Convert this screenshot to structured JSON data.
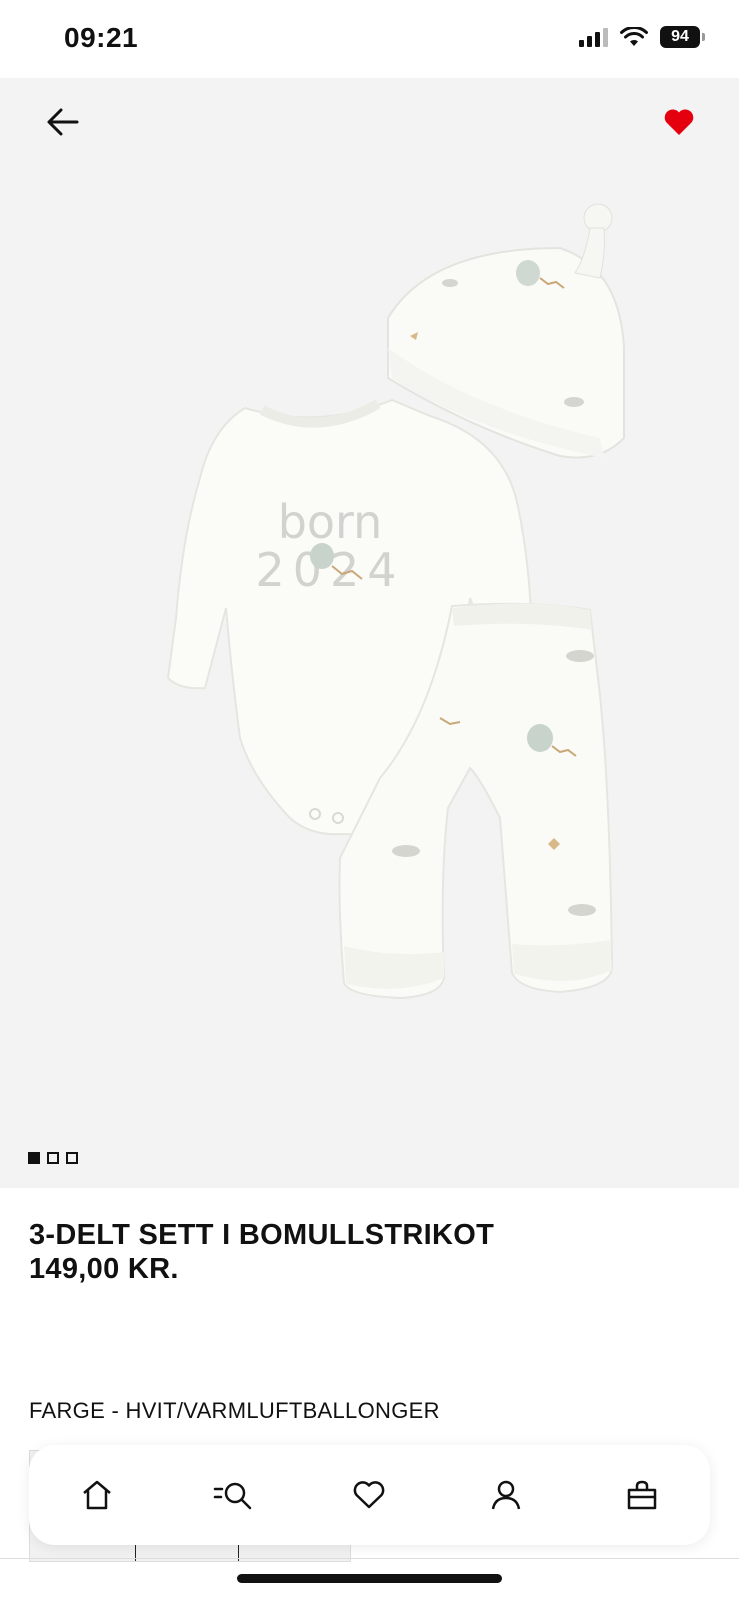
{
  "status": {
    "time": "09:21",
    "battery": "94"
  },
  "product": {
    "title": "3-DELT SETT I BOMULLSTRIKOT",
    "price": "149,00 KR.",
    "color_label": "FARGE - HVIT/VARMLUFTBALLONGER",
    "image_print_line1": "born",
    "image_print_line2": "2024",
    "image_count": 3,
    "active_image": 1,
    "favorited": true
  },
  "colors": {
    "accent": "#e50010",
    "hero_bg": "#f3f3f3"
  },
  "nav": [
    "home-icon",
    "search-icon",
    "heart-icon",
    "user-icon",
    "bag-icon"
  ]
}
